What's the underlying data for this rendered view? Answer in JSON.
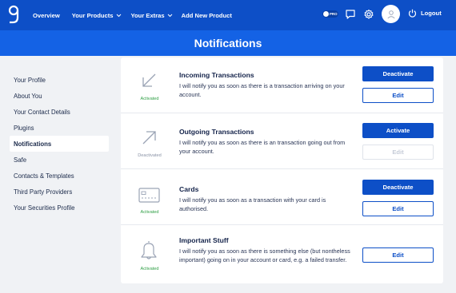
{
  "topbar": {
    "logo_icon": "logo-g-icon",
    "nav": [
      {
        "label": "Overview",
        "dropdown": false
      },
      {
        "label": "Your Products",
        "dropdown": true
      },
      {
        "label": "Your Extras",
        "dropdown": true
      },
      {
        "label": "Add New Product",
        "dropdown": false
      }
    ],
    "pro_toggle_label": "PRO",
    "icons": [
      "chat-icon",
      "gear-icon",
      "user-avatar-icon",
      "power-icon"
    ],
    "logout_label": "Logout"
  },
  "page_title": "Notifications",
  "sidebar": {
    "items": [
      {
        "label": "Your Profile",
        "active": false
      },
      {
        "label": "About You",
        "active": false
      },
      {
        "label": "Your Contact Details",
        "active": false
      },
      {
        "label": "Plugins",
        "active": false
      },
      {
        "label": "Notifications",
        "active": true
      },
      {
        "label": "Safe",
        "active": false
      },
      {
        "label": "Contacts & Templates",
        "active": false
      },
      {
        "label": "Third Party Providers",
        "active": false
      },
      {
        "label": "Your Securities Profile",
        "active": false
      }
    ]
  },
  "notifications": [
    {
      "icon": "arrow-down-left-icon",
      "status": "Activated",
      "title": "Incoming Transactions",
      "description": "I will notify you as soon as there is a transaction arriving on your account.",
      "primary_button": "Deactivate",
      "edit_button": "Edit",
      "edit_enabled": true
    },
    {
      "icon": "arrow-up-right-icon",
      "status": "Deactivated",
      "title": "Outgoing Transactions",
      "description": "I will notify you as soon as there is an transaction going out from your account.",
      "primary_button": "Activate",
      "edit_button": "Edit",
      "edit_enabled": false
    },
    {
      "icon": "card-icon",
      "status": "Activated",
      "title": "Cards",
      "description": "I will notify you as soon as a transaction with your card is authorised.",
      "primary_button": "Deactivate",
      "edit_button": "Edit",
      "edit_enabled": true
    },
    {
      "icon": "bell-icon",
      "status": "Activated",
      "title": "Important Stuff",
      "description": "I will notify you as soon as there is something else (but nontheless important) going on in your account or card, e.g. a failed transfer.",
      "primary_button": "",
      "edit_button": "Edit",
      "edit_enabled": true
    }
  ],
  "colors": {
    "topbar": "#0d4fc7",
    "header_band": "#1462e5",
    "activated": "#2e9e44",
    "deactivated": "#8a93a6"
  }
}
